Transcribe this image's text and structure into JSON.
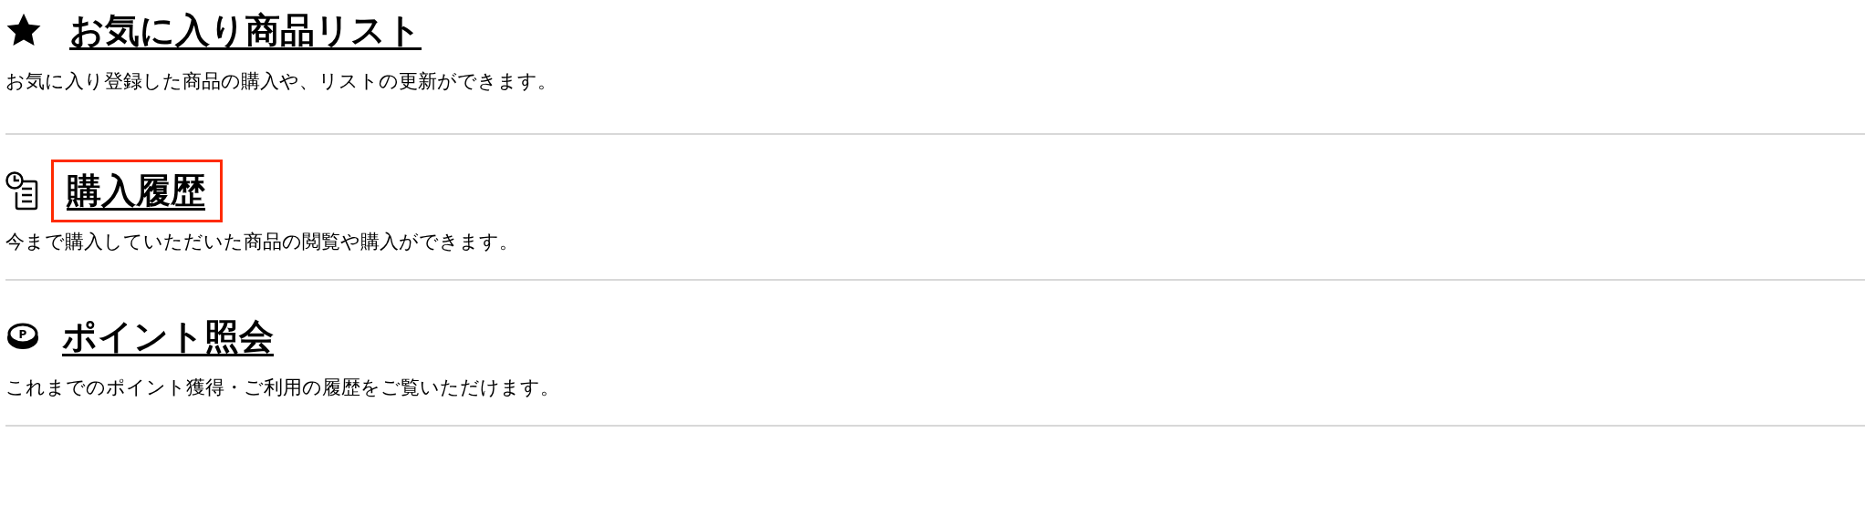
{
  "sections": [
    {
      "kind": "star",
      "title": "お気に入り商品リスト",
      "highlighted": false,
      "description": "お気に入り登録した商品の購入や、リストの更新ができます。"
    },
    {
      "kind": "history",
      "title": "購入履歴",
      "highlighted": true,
      "description": "今まで購入していただいた商品の閲覧や購入ができます。"
    },
    {
      "kind": "points",
      "icon_label": "P",
      "title": "ポイント照会",
      "highlighted": false,
      "description": "これまでのポイント獲得・ご利用の履歴をご覧いただけます。"
    }
  ]
}
